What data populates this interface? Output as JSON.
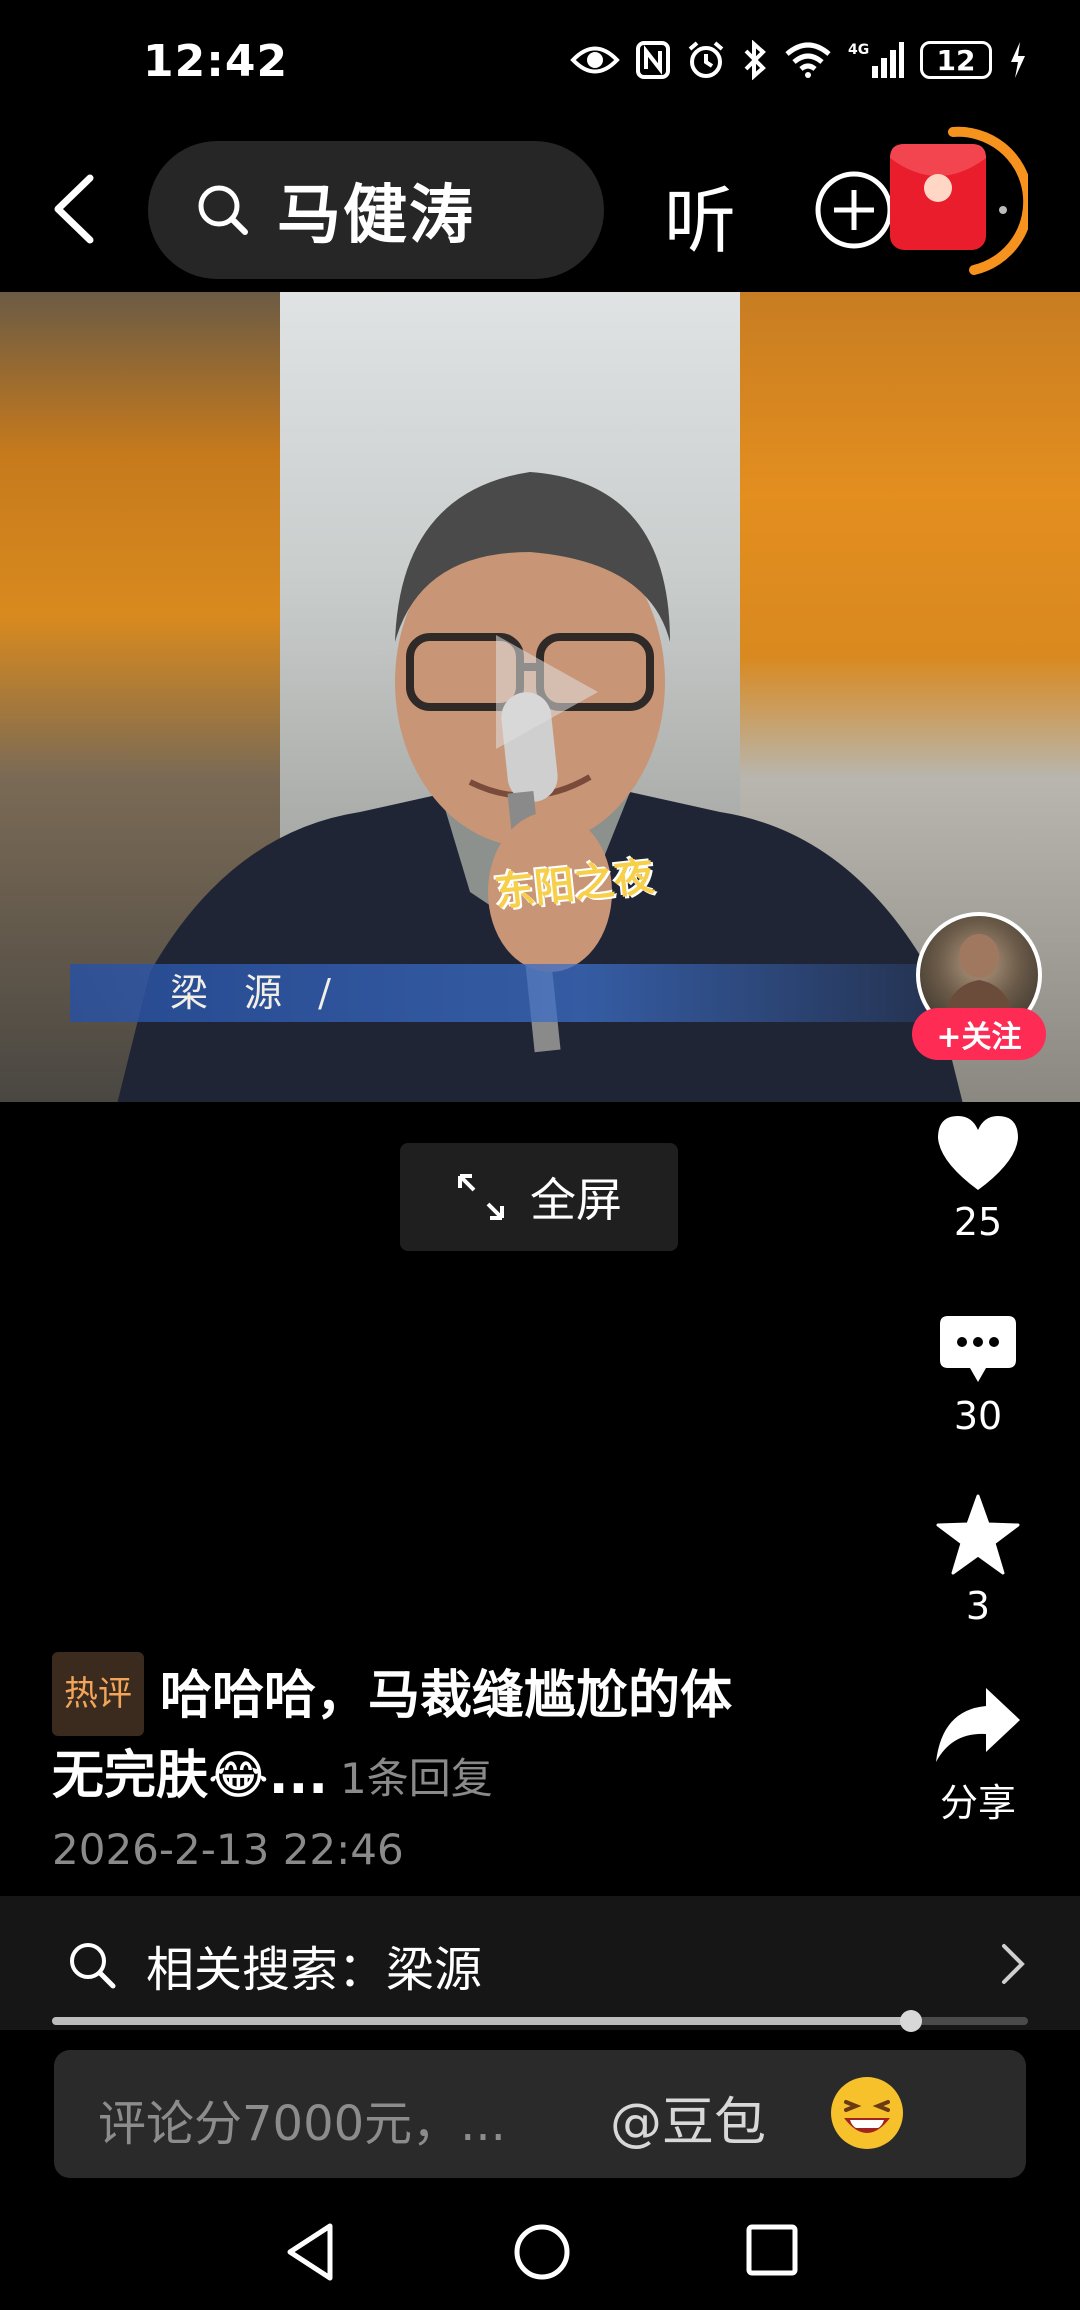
{
  "status_bar": {
    "time": "12:42",
    "battery": "12",
    "icons": [
      "eye-icon",
      "nfc-icon",
      "alarm-icon",
      "bluetooth-icon",
      "wifi-icon",
      "signal-4g-icon",
      "battery-icon",
      "charging-icon"
    ]
  },
  "topnav": {
    "search_query": "马健涛",
    "listen_label": "听"
  },
  "video": {
    "lower_third_name": "梁 源 /",
    "mic_sticker": "东阳之夜"
  },
  "creator": {
    "follow_label": "+关注"
  },
  "fullscreen": {
    "label": "全屏"
  },
  "actions": {
    "likes": "25",
    "comments": "30",
    "favorites": "3",
    "share_label": "分享"
  },
  "hot_comment": {
    "badge": "热评",
    "text_line1": "哈哈哈，马裁缝尴尬的体",
    "text_line2": "无完肤😂...",
    "reply_count": "1条回复",
    "date": "2026-2-13 22:46"
  },
  "related_search": {
    "label": "相关搜索：梁源"
  },
  "playback": {
    "progress": 0.88
  },
  "comment_input": {
    "placeholder": "评论分7000元，...",
    "mention": "@豆包"
  },
  "colors": {
    "accent_red": "#fe2c55",
    "hot_badge": "#f2a45a",
    "redpacket_ring": "#f6921e"
  }
}
